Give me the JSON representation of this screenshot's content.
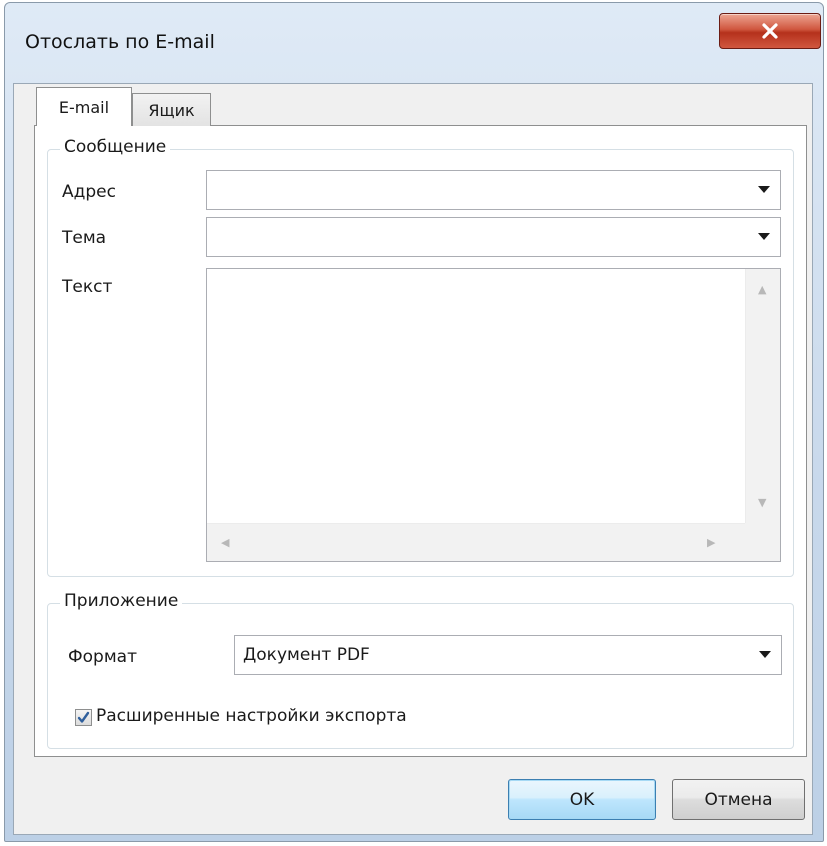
{
  "window": {
    "title": "Отослать по E-mail",
    "close_icon": "close-icon"
  },
  "tabs": [
    {
      "label": "E-mail",
      "selected": true
    },
    {
      "label": "Ящик",
      "selected": false
    }
  ],
  "message_group": {
    "legend": "Сообщение",
    "address_label": "Адрес",
    "address_value": "",
    "subject_label": "Тема",
    "subject_value": "",
    "text_label": "Текст",
    "text_value": ""
  },
  "attachment_group": {
    "legend": "Приложение",
    "format_label": "Формат",
    "format_value": "Документ PDF",
    "advanced_export_label": "Расширенные настройки экспорта",
    "advanced_export_checked": true
  },
  "buttons": {
    "ok_label": "OK",
    "cancel_label": "Отмена"
  },
  "colors": {
    "close_button": "#c9442c",
    "default_button_border": "#3c7fb1",
    "frame": "#c9d9ec"
  }
}
